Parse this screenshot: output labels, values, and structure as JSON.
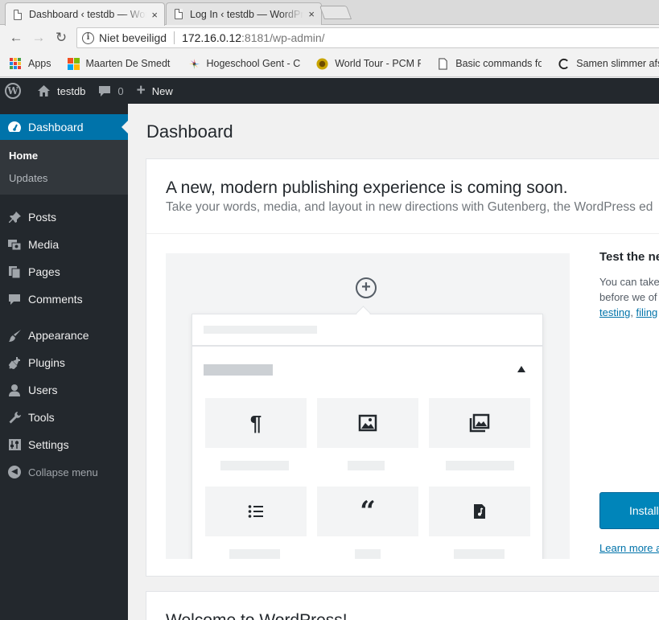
{
  "browser": {
    "tabs": [
      {
        "title": "Dashboard ‹ testdb — WordPress",
        "close": "×",
        "active": true
      },
      {
        "title": "Log In ‹ testdb — WordPress",
        "close": "×",
        "active": false
      }
    ],
    "address": {
      "security_label": "Niet beveiligd",
      "host": "172.16.0.12",
      "rest": ":8181/wp-admin/"
    },
    "bookmarks": [
      {
        "label": "Apps",
        "icon": "apps-grid-icon"
      },
      {
        "label": "Maarten De Smedt - C",
        "icon": "microsoft-logo-icon"
      },
      {
        "label": "Hogeschool Gent - C",
        "icon": "hogent-logo-icon"
      },
      {
        "label": "World Tour - PCM Fra",
        "icon": "pcm-logo-icon"
      },
      {
        "label": "Basic commands for E",
        "icon": "document-icon"
      },
      {
        "label": "Samen slimmer afslan",
        "icon": "circle-logo-icon"
      }
    ]
  },
  "adminbar": {
    "site_name": "testdb",
    "comments_count": "0",
    "new_label": "New"
  },
  "sidebar": {
    "dashboard": "Dashboard",
    "submenu": [
      "Home",
      "Updates"
    ],
    "items_group1": [
      "Posts",
      "Media",
      "Pages",
      "Comments"
    ],
    "items_group2": [
      "Appearance",
      "Plugins",
      "Users",
      "Tools",
      "Settings"
    ],
    "collapse": "Collapse menu"
  },
  "main": {
    "page_title": "Dashboard",
    "gutenberg": {
      "title": "A new, modern publishing experience is coming soon.",
      "subtitle": "Take your words, media, and layout in new directions with Gutenberg, the WordPress ed",
      "side_title": "Test the ne",
      "side_body_1": "You can take",
      "side_body_2": "before we of",
      "link_testing": "testing",
      "link_filing": "filing",
      "install_label": "Install",
      "learn_more": "Learn more a"
    },
    "welcome_title": "Welcome to WordPress!"
  },
  "colors": {
    "admin_dark": "#23282d",
    "accent_blue": "#0073aa",
    "button_blue": "#0085ba"
  }
}
